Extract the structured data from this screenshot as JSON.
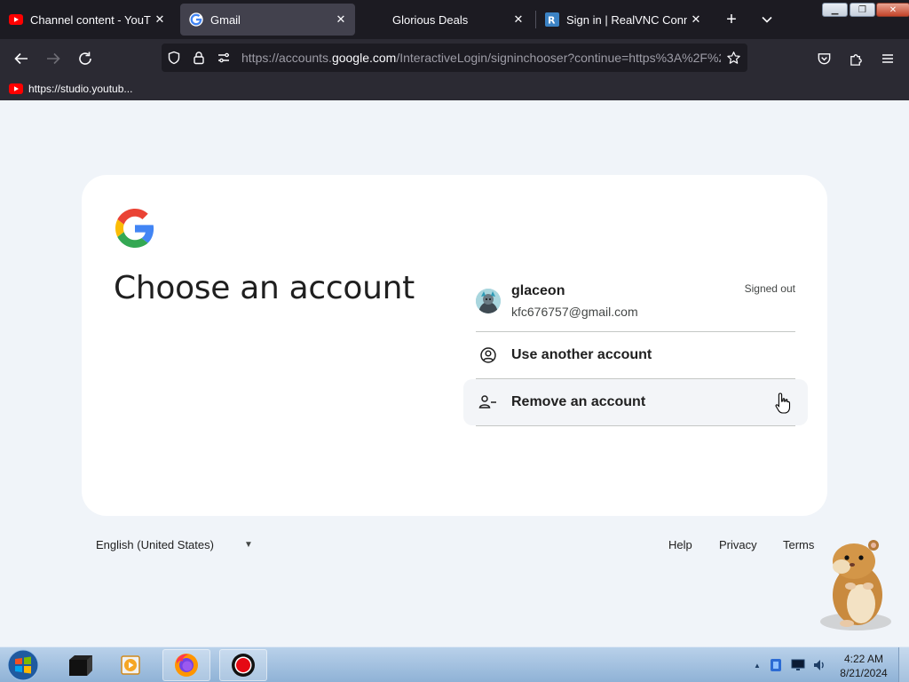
{
  "browser": {
    "tabs": [
      {
        "title": "Channel content - YouTube",
        "favicon": "youtube-icon",
        "active": false
      },
      {
        "title": "Gmail",
        "favicon": "google-icon",
        "active": true
      },
      {
        "title": "Glorious Deals",
        "favicon": "",
        "active": false
      },
      {
        "title": "Sign in | RealVNC Connect",
        "favicon": "realvnc-icon",
        "active": false
      }
    ],
    "new_tab_label": "+",
    "tab_list_label": "⌄",
    "url": {
      "prefix": "https://accounts.",
      "host": "google.com",
      "path": "/InteractiveLogin/signinchooser?continue=https%3A%2F%2"
    },
    "bookmarks": [
      {
        "label": "https://studio.youtub...",
        "favicon": "youtube-icon"
      }
    ],
    "colors": {
      "tabbar": "#1c1b22",
      "toolbar": "#2b2a33",
      "text": "#fbfbfe"
    }
  },
  "page": {
    "heading": "Choose an account",
    "account": {
      "name": "glaceon",
      "email": "kfc676757@gmail.com",
      "status": "Signed out"
    },
    "use_another": "Use another account",
    "remove": "Remove an account",
    "footer": {
      "language": "English (United States)",
      "links": {
        "help": "Help",
        "privacy": "Privacy",
        "terms": "Terms"
      }
    },
    "colors": {
      "background": "#f0f4f9",
      "card": "#ffffff",
      "text": "#1f1f1f"
    }
  },
  "taskbar": {
    "time": "4:22 AM",
    "date": "8/21/2024",
    "tray_expand": "▲"
  }
}
